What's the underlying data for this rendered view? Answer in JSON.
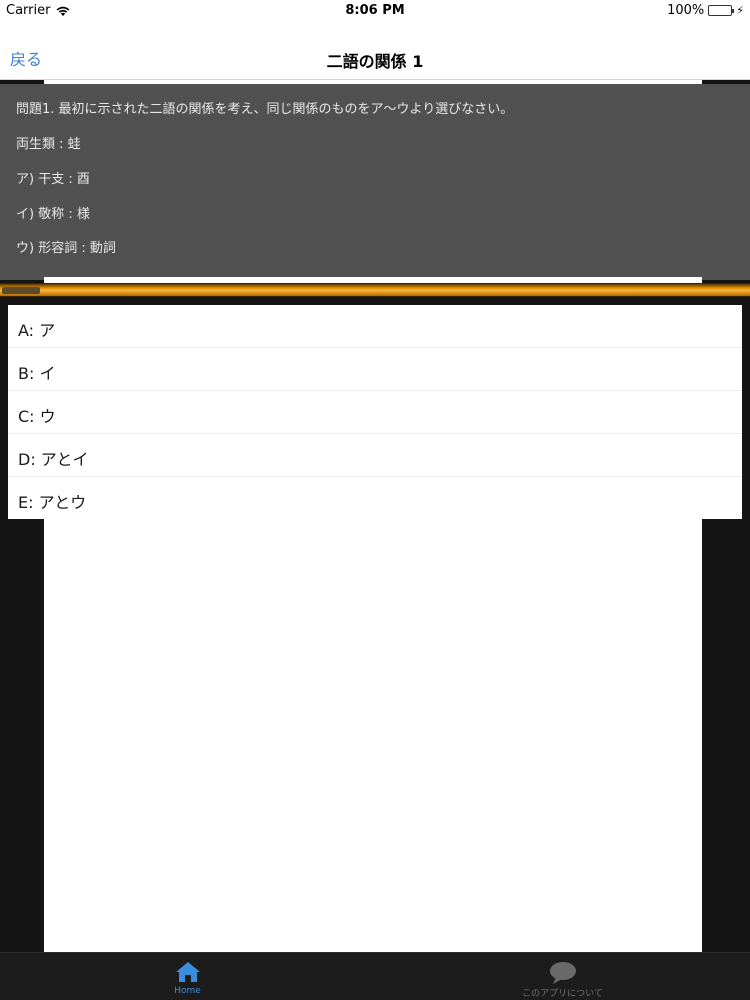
{
  "status_bar": {
    "carrier": "Carrier",
    "time": "8:06 PM",
    "battery": "100%"
  },
  "nav": {
    "back_label": "戻る",
    "title": "二語の関係 1"
  },
  "question": {
    "title": "問題1. 最初に示された二語の関係を考え、同じ関係のものをア〜ウより選びなさい。",
    "items": [
      "両生類 : 蛙",
      "ア) 干支 : 酉",
      "イ) 敬称 : 様",
      "ウ) 形容詞 : 動詞"
    ]
  },
  "answers": [
    "A: ア",
    "B: イ",
    "C: ウ",
    "D: アとイ",
    "E: アとウ"
  ],
  "tabs": {
    "home": "Home",
    "about": "このアプリについて"
  },
  "colors": {
    "accent": "#3b7fd6",
    "panel": "#525152",
    "slider": "#e8950a"
  }
}
